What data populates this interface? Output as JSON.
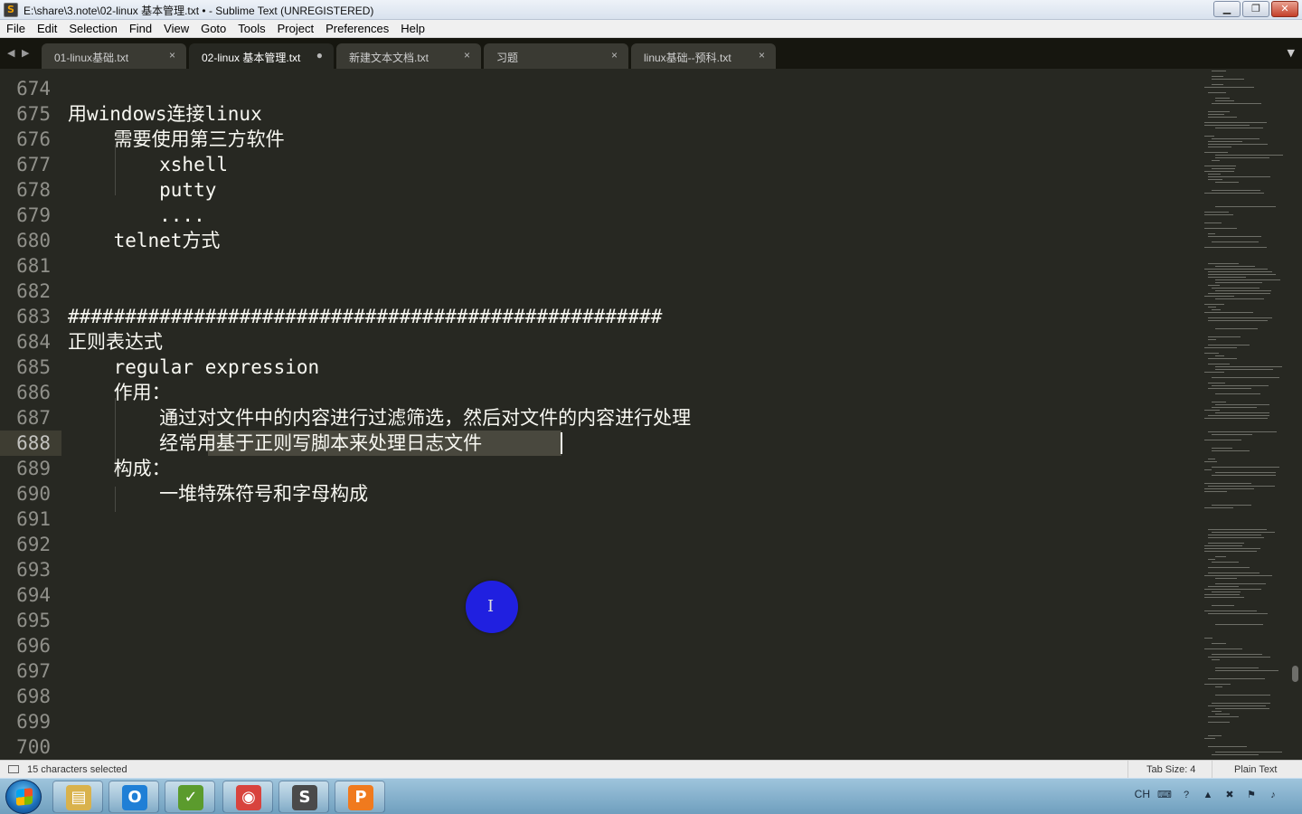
{
  "window": {
    "title": "E:\\share\\3.note\\02-linux 基本管理.txt • - Sublime Text (UNREGISTERED)",
    "minimize": "▁",
    "restore": "❐",
    "close": "✕"
  },
  "menu": [
    "File",
    "Edit",
    "Selection",
    "Find",
    "View",
    "Goto",
    "Tools",
    "Project",
    "Preferences",
    "Help"
  ],
  "tabs": [
    {
      "label": "01-linux基础.txt",
      "close": "×",
      "active": false
    },
    {
      "label": "02-linux 基本管理.txt",
      "close": "●",
      "active": true
    },
    {
      "label": "新建文本文档.txt",
      "close": "×",
      "active": false
    },
    {
      "label": "习题",
      "close": "×",
      "active": false
    },
    {
      "label": "linux基础--预科.txt",
      "close": "×",
      "active": false
    }
  ],
  "tabbar": {
    "prev": "◀",
    "next": "▶",
    "overflow": "▼"
  },
  "editor": {
    "current_line": 688,
    "lines": [
      {
        "num": "674",
        "text": ""
      },
      {
        "num": "675",
        "text": "用windows连接linux"
      },
      {
        "num": "676",
        "text": "    需要使用第三方软件"
      },
      {
        "num": "677",
        "text": "        xshell"
      },
      {
        "num": "678",
        "text": "        putty"
      },
      {
        "num": "679",
        "text": "        ...."
      },
      {
        "num": "680",
        "text": "    telnet方式"
      },
      {
        "num": "681",
        "text": ""
      },
      {
        "num": "682",
        "text": ""
      },
      {
        "num": "683",
        "text": "####################################################"
      },
      {
        "num": "684",
        "text": "正则表达式"
      },
      {
        "num": "685",
        "text": "    regular expression"
      },
      {
        "num": "686",
        "text": "    作用："
      },
      {
        "num": "687",
        "text": "        通过对文件中的内容进行过滤筛选，然后对文件的内容进行处理"
      },
      {
        "num": "688",
        "text": "        经常用基于正则写脚本来处理日志文件"
      },
      {
        "num": "689",
        "text": "    构成："
      },
      {
        "num": "690",
        "text": "        一堆特殊符号和字母构成"
      },
      {
        "num": "691",
        "text": ""
      },
      {
        "num": "692",
        "text": ""
      },
      {
        "num": "693",
        "text": ""
      },
      {
        "num": "694",
        "text": ""
      },
      {
        "num": "695",
        "text": ""
      },
      {
        "num": "696",
        "text": ""
      },
      {
        "num": "697",
        "text": ""
      },
      {
        "num": "698",
        "text": ""
      },
      {
        "num": "699",
        "text": ""
      },
      {
        "num": "700",
        "text": ""
      }
    ],
    "cursor_glyph": "I"
  },
  "status": {
    "selection": "15 characters selected",
    "tab_size": "Tab Size: 4",
    "syntax": "Plain Text"
  },
  "taskbar": {
    "items": [
      {
        "name": "explorer",
        "glyph": "▤",
        "color": "#d9b24c"
      },
      {
        "name": "outlook",
        "glyph": "O",
        "color": "#1f7fd6"
      },
      {
        "name": "network-tool",
        "glyph": "✓",
        "color": "#5b9b2d"
      },
      {
        "name": "snail-app",
        "glyph": "◉",
        "color": "#d8433d"
      },
      {
        "name": "sublime-text",
        "glyph": "S",
        "color": "#4a4a4a"
      },
      {
        "name": "presentation",
        "glyph": "P",
        "color": "#f07a1e"
      }
    ],
    "tray": {
      "lang": "CH",
      "help": "?",
      "arrow": "▲"
    }
  }
}
